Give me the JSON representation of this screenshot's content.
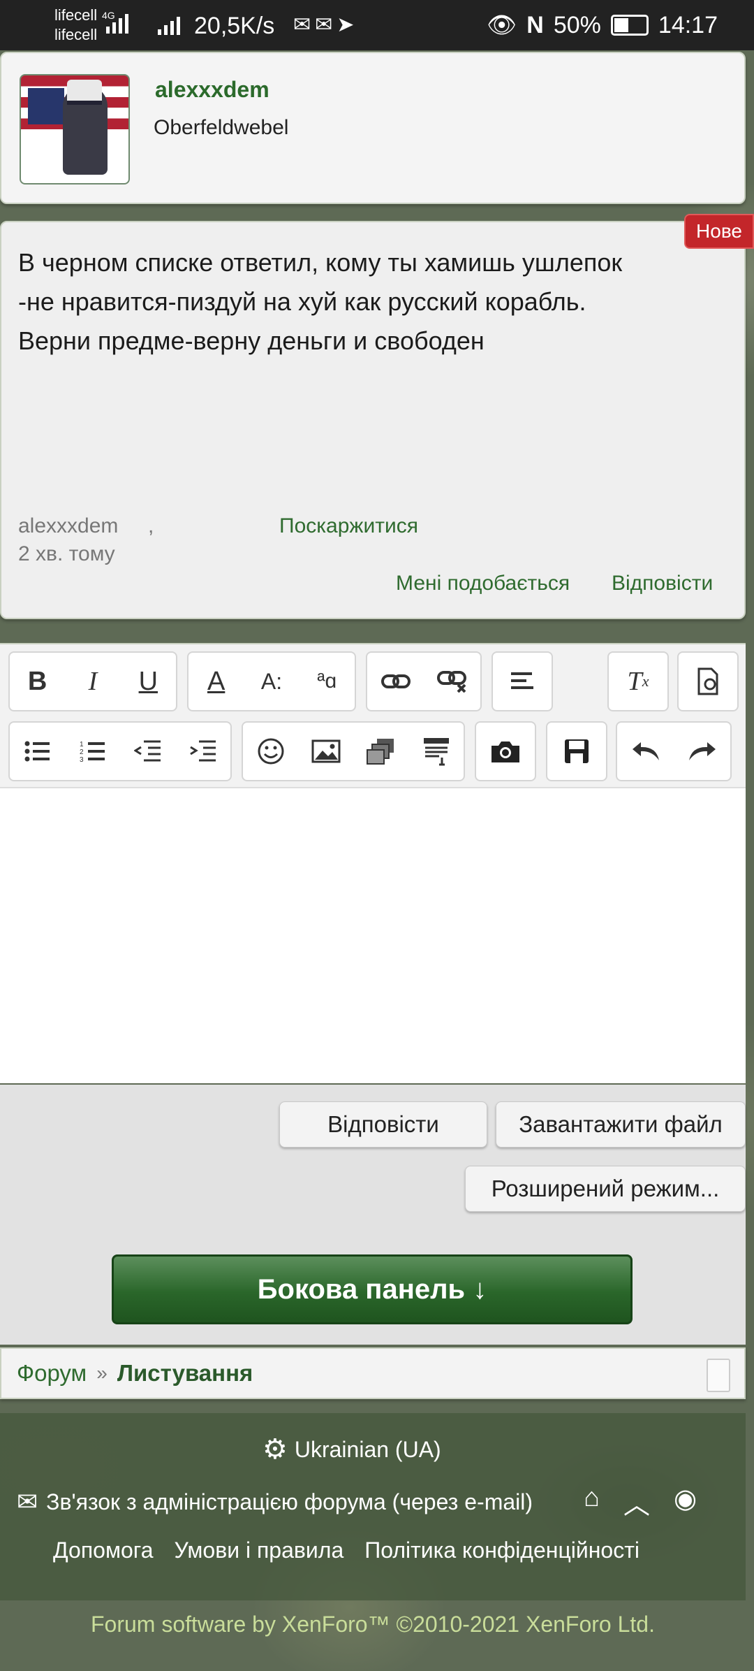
{
  "status_bar": {
    "carrier1": "lifecell",
    "carrier2": "lifecell",
    "network": "4G",
    "speed": "20,5K/s",
    "battery": "50%",
    "time": "14:17"
  },
  "profile": {
    "username": "alexxxdem",
    "title": "Oberfeldwebel"
  },
  "message": {
    "badge": "Нове",
    "lines": [
      "В черном списке ответил, кому ты хамишь ушлепок",
      "-не нравится-пиздуй на хуй как русский корабль.",
      "Верни предме-верну деньги и свободен"
    ],
    "author": "alexxxdem",
    "separator": ",",
    "report": "Поскаржитися",
    "time": "2 хв. тому",
    "like": "Мені подобається",
    "reply": "Відповісти"
  },
  "editor": {
    "toolbar_row1": [
      "bold-icon",
      "italic-icon",
      "underline-icon",
      "text-color-icon",
      "font-size-icon",
      "font-family-icon",
      "link-icon",
      "unlink-icon",
      "align-icon",
      "remove-format-icon",
      "toggle-bbcode-icon"
    ],
    "toolbar_row2": [
      "bullet-list-icon",
      "numbered-list-icon",
      "outdent-icon",
      "indent-icon",
      "smilie-icon",
      "image-icon",
      "media-icon",
      "insert-icon",
      "camera-icon",
      "save-draft-icon",
      "undo-icon",
      "redo-icon"
    ]
  },
  "controls": {
    "reply_button": "Відповісти",
    "upload_button": "Завантажити файл",
    "advanced_button": "Розширений режим...",
    "sidebar_button": "Бокова панель ↓"
  },
  "breadcrumb": {
    "forum": "Форум",
    "separator": "»",
    "current": "Листування"
  },
  "footer": {
    "language": "Ukrainian (UA)",
    "contact": "Зв'язок з адміністрацією форума (через e-mail)",
    "links": [
      "Допомога",
      "Умови і правила",
      "Політика конфіденційності"
    ],
    "copyright": "Forum software by XenForo™ ©2010-2021 XenForo Ltd."
  }
}
